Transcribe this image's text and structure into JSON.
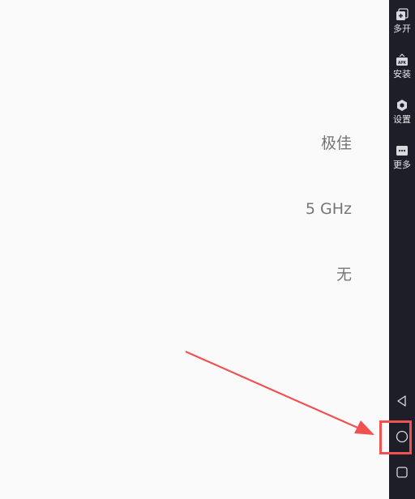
{
  "settings_values": {
    "signal_strength": "极佳",
    "frequency": "5 GHz",
    "security": "无"
  },
  "sidebar": {
    "multi_open": "多开",
    "install": "安装",
    "settings": "设置",
    "more": "更多"
  },
  "colors": {
    "sidebar_bg": "#1d1e27",
    "highlight": "#f05252",
    "value_text": "#757575"
  }
}
